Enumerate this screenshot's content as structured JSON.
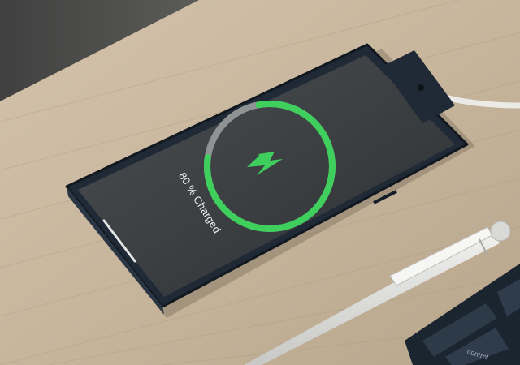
{
  "phone": {
    "charge_label": "80 % Charged",
    "charge_level_percent": 80,
    "ring_color": "#3ecf5c",
    "bolt_color": "#3ecf5c",
    "center_icon": "lightning-bolt-icon"
  },
  "keyboard": {
    "key_label": "control"
  },
  "colors": {
    "desk": "#c9b79f",
    "phone_frame": "#1f2a36",
    "screen": "#3d4143"
  }
}
